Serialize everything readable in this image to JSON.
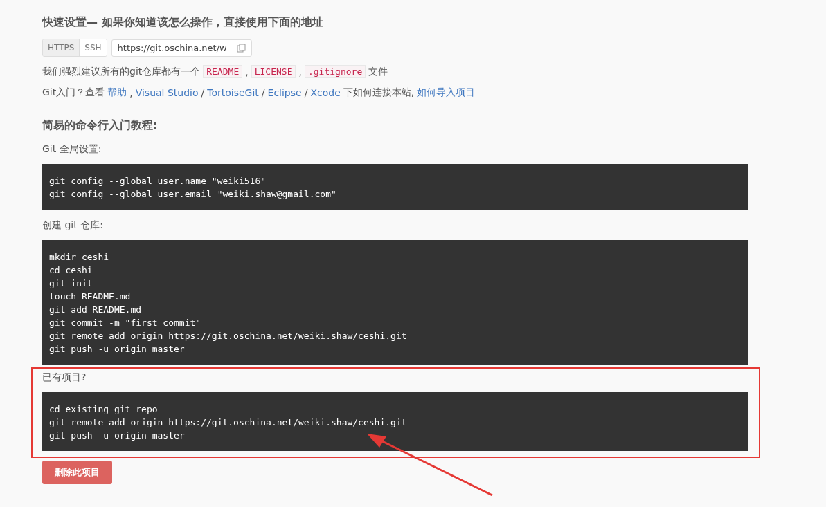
{
  "quick_setup": {
    "title": "快速设置— 如果你知道该怎么操作，直接使用下面的地址",
    "protocols": [
      {
        "label": "HTTPS",
        "selected": true
      },
      {
        "label": "SSH",
        "selected": false
      }
    ],
    "url": "https://git.oschina.net/w",
    "recommend": [
      {
        "kind": "text",
        "text": "我们强烈建议所有的git仓库都有一个"
      },
      {
        "kind": "code",
        "text": "README"
      },
      {
        "kind": "text",
        "text": ","
      },
      {
        "kind": "code",
        "text": "LICENSE"
      },
      {
        "kind": "text",
        "text": ","
      },
      {
        "kind": "code",
        "text": ".gitignore"
      },
      {
        "kind": "text",
        "text": "文件"
      }
    ],
    "intro": [
      {
        "kind": "text",
        "text": "Git入门？查看"
      },
      {
        "kind": "link",
        "text": "帮助"
      },
      {
        "kind": "text",
        "text": ","
      },
      {
        "kind": "link",
        "text": "Visual Studio"
      },
      {
        "kind": "text",
        "text": "/"
      },
      {
        "kind": "link",
        "text": "TortoiseGit"
      },
      {
        "kind": "text",
        "text": "/"
      },
      {
        "kind": "link",
        "text": "Eclipse"
      },
      {
        "kind": "text",
        "text": "/"
      },
      {
        "kind": "link",
        "text": "Xcode"
      },
      {
        "kind": "text",
        "text": "下如何连接本站,"
      },
      {
        "kind": "link",
        "text": "如何导入项目"
      }
    ]
  },
  "tutorial": {
    "title": "简易的命令行入门教程:",
    "sections": [
      {
        "label": "Git 全局设置:",
        "highlighted": false,
        "code": [
          "git config --global user.name \"weiki516\"",
          "git config --global user.email \"weiki.shaw@gmail.com\""
        ]
      },
      {
        "label": "创建 git 仓库:",
        "highlighted": false,
        "code": [
          "mkdir ceshi",
          "cd ceshi",
          "git init",
          "touch README.md",
          "git add README.md",
          "git commit -m \"first commit\"",
          "git remote add origin https://git.oschina.net/weiki.shaw/ceshi.git",
          "git push -u origin master"
        ]
      },
      {
        "label": "已有项目?",
        "highlighted": true,
        "code": [
          "cd existing_git_repo",
          "git remote add origin https://git.oschina.net/weiki.shaw/ceshi.git",
          "git push -u origin master"
        ]
      }
    ]
  },
  "delete_button": "删除此项目"
}
